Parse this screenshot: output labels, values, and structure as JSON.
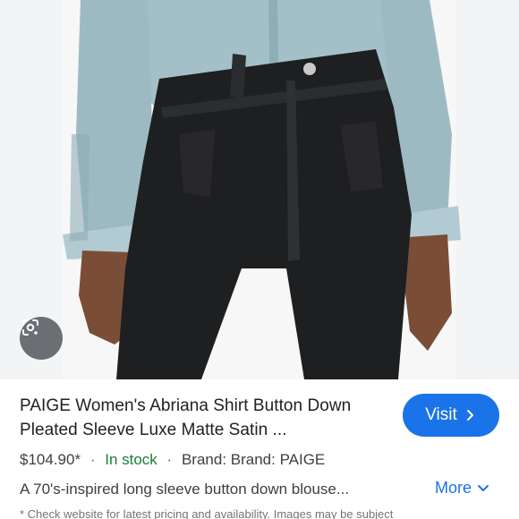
{
  "product": {
    "title": "PAIGE Women's Abriana Shirt Button Down Pleated Sleeve Luxe Matte Satin ...",
    "price": "$104.90*",
    "separator": "·",
    "stock_status": "In stock",
    "brand_text": "Brand: Brand: PAIGE",
    "description": "A 70's-inspired long sleeve button down blouse...",
    "disclaimer": "* Check website for latest pricing and availability. Images may be subject"
  },
  "actions": {
    "visit_label": "Visit",
    "visit_icon": "chevron-right-icon",
    "more_label": "More",
    "more_icon": "chevron-down-icon",
    "lens_icon": "google-lens-icon"
  },
  "colors": {
    "accent": "#1a73e8",
    "stock": "#188038",
    "text": "#202124",
    "secondary_text": "#3c4043",
    "shirt": "#9fbcc4",
    "leather": "#1e1f21"
  }
}
